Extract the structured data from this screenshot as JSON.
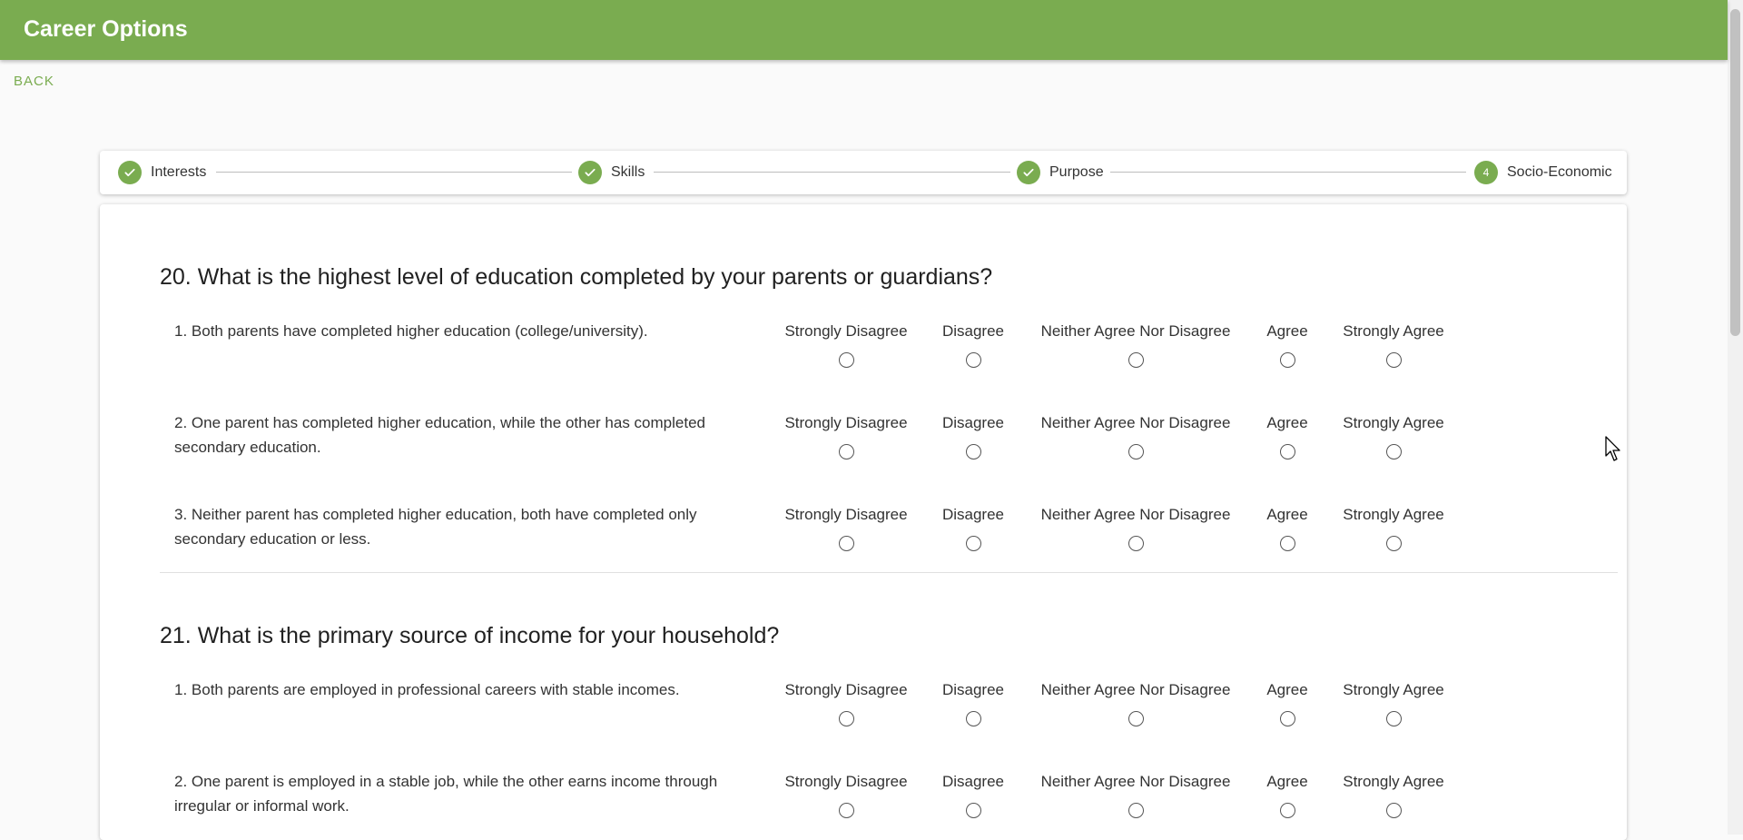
{
  "app": {
    "title": "Career Options",
    "back_label": "BACK"
  },
  "stepper": {
    "steps": [
      {
        "label": "Interests",
        "status": "completed"
      },
      {
        "label": "Skills",
        "status": "completed"
      },
      {
        "label": "Purpose",
        "status": "completed"
      },
      {
        "label": "Socio-Economic",
        "status": "active",
        "number": "4"
      }
    ]
  },
  "scale_options": [
    "Strongly Disagree",
    "Disagree",
    "Neither Agree Nor Disagree",
    "Agree",
    "Strongly Agree"
  ],
  "questions": [
    {
      "title": "20. What is the highest level of education completed by your parents or guardians?",
      "statements": [
        "1. Both parents have completed higher education (college/university).",
        "2. One parent has completed higher education, while the other has completed secondary education.",
        "3. Neither parent has completed higher education, both have completed only secondary education or less."
      ]
    },
    {
      "title": "21. What is the primary source of income for your household?",
      "statements": [
        "1. Both parents are employed in professional careers with stable incomes.",
        "2. One parent is employed in a stable job, while the other earns income through irregular or informal work."
      ]
    }
  ],
  "colors": {
    "accent": "#7aac50",
    "background": "#fafafa",
    "card": "#ffffff"
  }
}
